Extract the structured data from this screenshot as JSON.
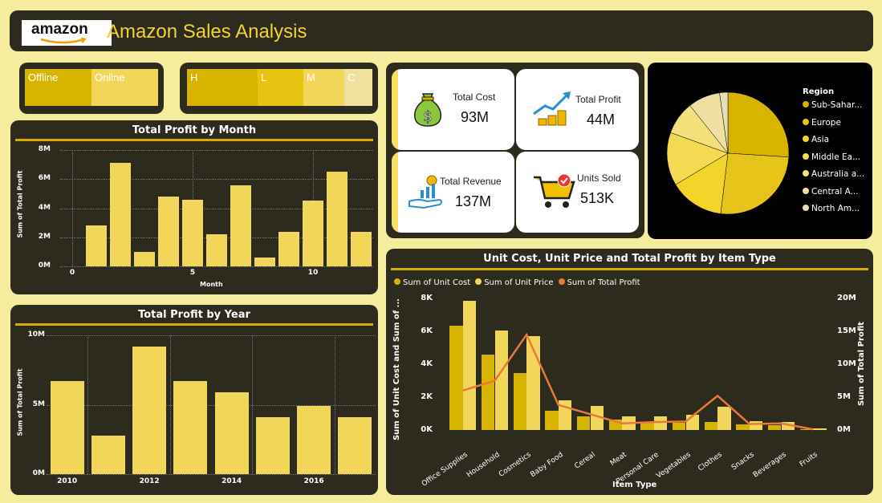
{
  "header": {
    "logo_text": "amazon",
    "title": "Amazon Sales Analysis"
  },
  "slicer_channel": {
    "items": [
      "Offline",
      "Online"
    ]
  },
  "slicer_priority": {
    "items": [
      "H",
      "L",
      "M",
      "C"
    ]
  },
  "kpis": [
    {
      "label": "Total Cost",
      "value": "93M",
      "icon": "money-bag-icon"
    },
    {
      "label": "Total Profit",
      "value": "44M",
      "icon": "growth-coins-icon"
    },
    {
      "label": "Total Revenue",
      "value": "137M",
      "icon": "revenue-hand-icon"
    },
    {
      "label": "Units Sold",
      "value": "513K",
      "icon": "shopping-cart-icon"
    }
  ],
  "colors": {
    "bg": "#f5ec9e",
    "panel": "#2d2a1e",
    "bar": "#f2d659",
    "accent": "#d4af00",
    "line": "#e8793a"
  },
  "chart_data": [
    {
      "type": "bar",
      "title": "Total Profit by Month",
      "xlabel": "Month",
      "ylabel": "Sum of Total Profit",
      "x": [
        1,
        2,
        3,
        4,
        5,
        6,
        7,
        8,
        9,
        10,
        11,
        12
      ],
      "values": [
        2.8,
        7.1,
        1.0,
        4.8,
        4.6,
        2.2,
        5.6,
        0.6,
        2.4,
        4.5,
        6.5,
        2.4
      ],
      "value_unit": "M",
      "ylim": [
        0,
        8
      ],
      "yticks": [
        "0M",
        "2M",
        "4M",
        "6M",
        "8M"
      ],
      "xticks": [
        "0",
        "5",
        "10"
      ],
      "grid": true
    },
    {
      "type": "bar",
      "title": "Total Profit by Year",
      "ylabel": "Sum of Total Profit",
      "x": [
        2010,
        2011,
        2012,
        2013,
        2014,
        2015,
        2016,
        2017
      ],
      "values": [
        6.7,
        2.8,
        9.2,
        6.7,
        5.9,
        4.1,
        4.9,
        4.1
      ],
      "value_unit": "M",
      "ylim": [
        0,
        10
      ],
      "yticks": [
        "0M",
        "5M",
        "10M"
      ],
      "xticks": [
        "2010",
        "2012",
        "2014",
        "2016"
      ],
      "grid": true
    },
    {
      "type": "pie",
      "legend_title": "Region",
      "legend_position": "right",
      "labels": [
        "Sub-Sahar...",
        "Europe",
        "Asia",
        "Middle Ea...",
        "Australia a...",
        "Central A...",
        "North Am..."
      ],
      "values": [
        26.0,
        25.9,
        14.5,
        14.1,
        8.8,
        8.5,
        2.2
      ],
      "colors": [
        "#d6b400",
        "#e6c41a",
        "#f2d42b",
        "#f3da52",
        "#f5e17b",
        "#eee0a3",
        "#e8dcbf"
      ]
    },
    {
      "type": "bar",
      "title": "Unit Cost, Unit Price and Total Profit by Item Type",
      "xlabel": "Item Type",
      "ylabel": "Sum of Unit Cost and Sum of ...",
      "y2label": "Sum of Total Profit",
      "categories": [
        "Office Supplies",
        "Household",
        "Cosmetics",
        "Baby Food",
        "Cereal",
        "Meat",
        "Personal Care",
        "Vegetables",
        "Clothes",
        "Snacks",
        "Beverages",
        "Fruits"
      ],
      "series": [
        {
          "name": "Sum of Unit Cost",
          "values": [
            6350,
            4600,
            3450,
            1150,
            850,
            650,
            500,
            450,
            500,
            350,
            300,
            50
          ],
          "color": "#d6b400"
        },
        {
          "name": "Sum of Unit Price",
          "values": [
            7850,
            6050,
            5700,
            1800,
            1450,
            850,
            850,
            950,
            1400,
            550,
            500,
            100
          ],
          "color": "#f2d659"
        },
        {
          "name": "Sum of Total Profit",
          "values": [
            6.0,
            7.5,
            14.5,
            3.8,
            2.4,
            1.0,
            1.2,
            1.3,
            5.2,
            0.9,
            1.0,
            0.1
          ],
          "axis": "secondary",
          "type": "line",
          "color": "#e8793a"
        }
      ],
      "ylim": [
        0,
        8000
      ],
      "y2lim": [
        0,
        20
      ],
      "yticks": [
        "0K",
        "2K",
        "4K",
        "6K",
        "8K"
      ],
      "y2ticks": [
        "0M",
        "5M",
        "10M",
        "15M",
        "20M"
      ],
      "grid": false
    }
  ]
}
